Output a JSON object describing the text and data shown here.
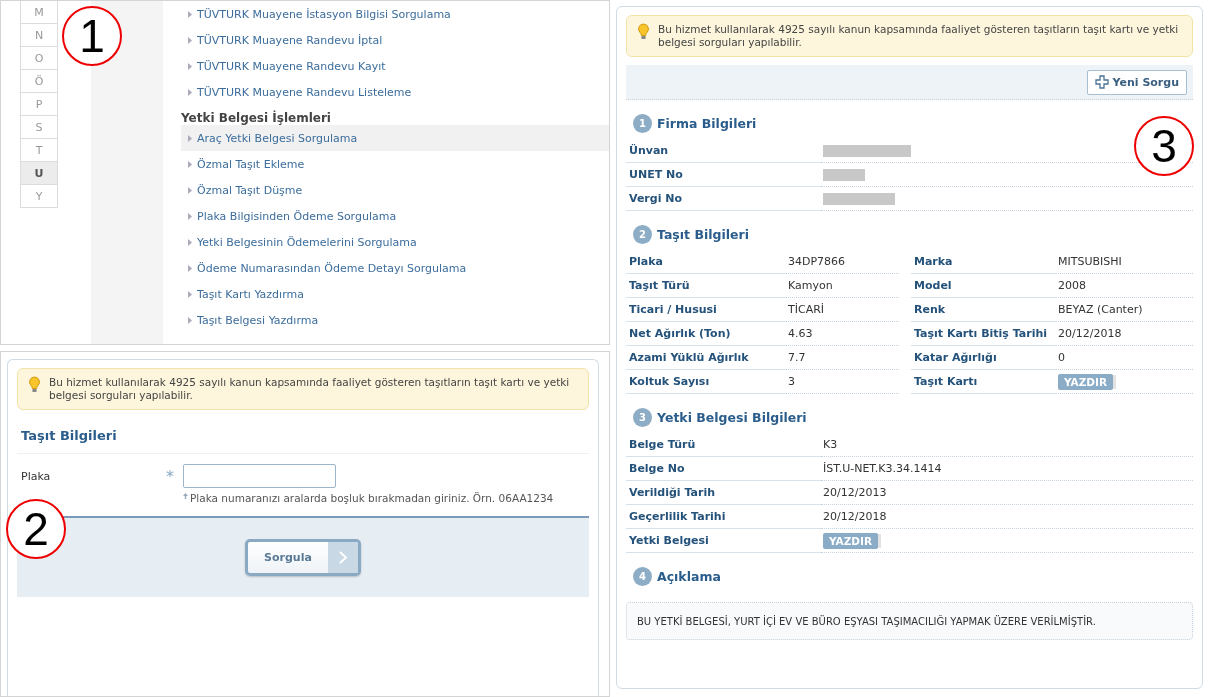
{
  "panel_1": {
    "letters": [
      {
        "label": "M",
        "selected": false
      },
      {
        "label": "N",
        "selected": false
      },
      {
        "label": "O",
        "selected": false
      },
      {
        "label": "Ö",
        "selected": false
      },
      {
        "label": "P",
        "selected": false
      },
      {
        "label": "S",
        "selected": false
      },
      {
        "label": "T",
        "selected": false
      },
      {
        "label": "U",
        "selected": true
      },
      {
        "label": "Y",
        "selected": false
      }
    ],
    "menu": [
      {
        "kind": "item",
        "label": "TÜVTURK Muayene İstasyon Bilgisi Sorgulama",
        "selected": false
      },
      {
        "kind": "item",
        "label": "TÜVTURK Muayene Randevu İptal",
        "selected": false
      },
      {
        "kind": "item",
        "label": "TÜVTURK Muayene Randevu Kayıt",
        "selected": false
      },
      {
        "kind": "item",
        "label": "TÜVTURK Muayene Randevu Listeleme",
        "selected": false
      },
      {
        "kind": "heading",
        "label": "Yetki Belgesi İşlemleri"
      },
      {
        "kind": "item",
        "label": "Araç Yetki Belgesi Sorgulama",
        "selected": true
      },
      {
        "kind": "item",
        "label": "Özmal Taşıt Ekleme",
        "selected": false
      },
      {
        "kind": "item",
        "label": "Özmal Taşıt Düşme",
        "selected": false
      },
      {
        "kind": "item",
        "label": "Plaka Bilgisinden Ödeme Sorgulama",
        "selected": false
      },
      {
        "kind": "item",
        "label": "Yetki Belgesinin Ödemelerini Sorgulama",
        "selected": false
      },
      {
        "kind": "item",
        "label": "Ödeme Numarasından Ödeme Detayı Sorgulama",
        "selected": false
      },
      {
        "kind": "item",
        "label": "Taşıt Kartı Yazdırma",
        "selected": false
      },
      {
        "kind": "item",
        "label": "Taşıt Belgesi Yazdırma",
        "selected": false
      }
    ]
  },
  "panel_2": {
    "notice": "Bu hizmet kullanılarak 4925 sayılı kanun kapsamında faaliyet gösteren taşıtların taşıt kartı ve yetki belgesi sorguları yapılabilir.",
    "section_title": "Taşıt Bilgileri",
    "field": {
      "label": "Plaka",
      "required_mark": "*",
      "hint": "Plaka numaranızı aralarda boşluk bırakmadan giriniz. Örn. 06AA1234"
    },
    "button": "Sorgula"
  },
  "panel_3": {
    "notice": "Bu hizmet kullanılarak 4925 sayılı kanun kapsamında faaliyet gösteren taşıtların taşıt kartı ve yetki belgesi sorguları yapılabilir.",
    "new_query_button": "Yeni Sorgu",
    "sections": [
      {
        "kind": "list",
        "number": "1",
        "title": "Firma Bilgileri",
        "rows": [
          {
            "kind": "redacted",
            "label": "Ünvan"
          },
          {
            "kind": "redacted",
            "label": "UNET No"
          },
          {
            "kind": "redacted",
            "label": "Vergi No"
          }
        ]
      },
      {
        "kind": "grid",
        "number": "2",
        "title": "Taşıt Bilgileri",
        "rows": [
          {
            "kind": "text",
            "label": "Plaka",
            "value": "34DP7866"
          },
          {
            "kind": "text",
            "label": "Marka",
            "value": "MITSUBISHI"
          },
          {
            "kind": "text",
            "label": "Taşıt Türü",
            "value": "Kamyon"
          },
          {
            "kind": "text",
            "label": "Model",
            "value": "2008"
          },
          {
            "kind": "text",
            "label": "Ticari / Hususi",
            "value": "TİCARİ"
          },
          {
            "kind": "text",
            "label": "Renk",
            "value": "BEYAZ (Canter)"
          },
          {
            "kind": "text",
            "label": "Net Ağırlık (Ton)",
            "value": "4.63"
          },
          {
            "kind": "text",
            "label": "Taşıt Kartı Bitiş Tarihi",
            "value": "20/12/2018"
          },
          {
            "kind": "text",
            "label": "Azami Yüklü Ağırlık",
            "value": "7.7"
          },
          {
            "kind": "text",
            "label": "Katar Ağırlığı",
            "value": "0"
          },
          {
            "kind": "text",
            "label": "Koltuk Sayısı",
            "value": "3"
          },
          {
            "kind": "print",
            "label": "Taşıt Kartı",
            "value": "YAZDIR"
          }
        ]
      },
      {
        "kind": "list",
        "number": "3",
        "title": "Yetki Belgesi Bilgileri",
        "rows": [
          {
            "kind": "text",
            "label": "Belge Türü",
            "value": "K3"
          },
          {
            "kind": "text",
            "label": "Belge No",
            "value": "İST.U-NET.K3.34.1414"
          },
          {
            "kind": "text",
            "label": "Verildiği Tarih",
            "value": "20/12/2013"
          },
          {
            "kind": "text",
            "label": "Geçerlilik Tarihi",
            "value": "20/12/2018"
          },
          {
            "kind": "print",
            "label": "Yetki Belgesi",
            "value": "YAZDIR"
          }
        ]
      },
      {
        "kind": "note",
        "number": "4",
        "title": "Açıklama",
        "text": "BU YETKİ BELGESİ, YURT İÇİ EV VE BÜRO EŞYASI TAŞIMACILIĞI YAPMAK ÜZERE VERİLMİŞTİR."
      }
    ]
  },
  "callouts": [
    "1",
    "2",
    "3"
  ]
}
